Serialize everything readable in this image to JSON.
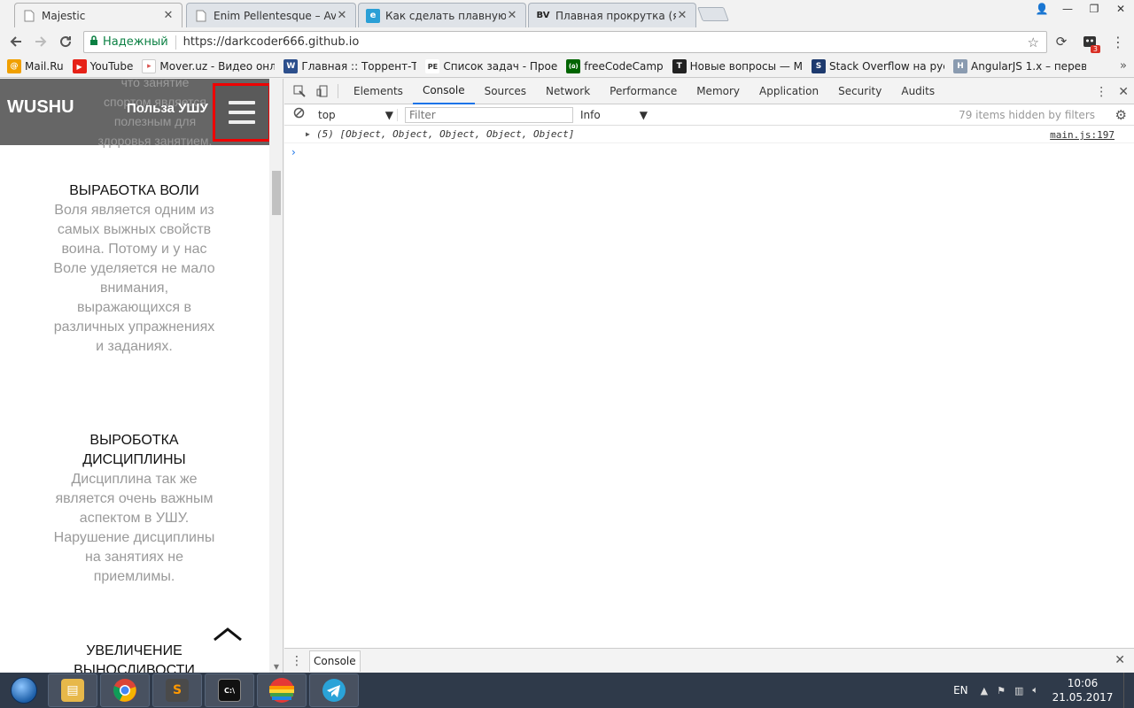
{
  "tabs": [
    {
      "title": "Majestic",
      "icon": "page-icon",
      "active": true
    },
    {
      "title": "Enim Pellentesque – Ava",
      "icon": "page-icon",
      "active": false
    },
    {
      "title": "Как сделать плавную пр",
      "icon": "e-icon",
      "active": false
    },
    {
      "title": "Плавная прокрутка (яко",
      "icon": "bv-icon",
      "active": false
    }
  ],
  "tab_icons": {
    "bv_label": "BV",
    "e_label": "e"
  },
  "window_controls": {
    "user": "👤",
    "minimize": "—",
    "maximize": "❐",
    "close": "✕"
  },
  "address_bar": {
    "secure_label": "Надежный",
    "url": "https://darkcoder666.github.io",
    "ext_badge": "3"
  },
  "bookmarks": [
    {
      "label": "Mail.Ru",
      "icon": "@",
      "color": "#f0a000"
    },
    {
      "label": "YouTube",
      "icon": "▶",
      "color": "#e62117"
    },
    {
      "label": "Mover.uz - Видео онл",
      "icon": "▸",
      "color": "#d9534f"
    },
    {
      "label": "Главная :: Торрент-Тр",
      "icon": "W",
      "color": "#2c4f8c"
    },
    {
      "label": "Список задач - Прое",
      "icon": "PE",
      "color": "#333333"
    },
    {
      "label": "freeCodeCamp",
      "icon": "(۵)",
      "color": "#006400"
    },
    {
      "label": "Новые вопросы — М",
      "icon": "T",
      "color": "#222222"
    },
    {
      "label": "Stack Overflow на рус",
      "icon": "S",
      "color": "#1e3a6e"
    },
    {
      "label": "AngularJS 1.x – перев",
      "icon": "H",
      "color": "#8a9bb0"
    }
  ],
  "bookmarks_more": "»",
  "site": {
    "logo": "WUSHU",
    "nav_title": "Польза УШУ",
    "header_bg_text": "что занятие спортом является полезным для здоровья занятием.",
    "sections": [
      {
        "title": "ВЫРАБОТКА ВОЛИ",
        "text": "Воля является одним из самых выжных свойств воина. Потому и у нас Воле уделяется не мало внимания, выражающихся в различных упражнениях и заданиях."
      },
      {
        "title": "ВЫРОБОТКА ДИСЦИПЛИНЫ",
        "text": "Дисциплина так же является очень важным аспектом в УШУ. Нарушение дисциплины на занятиях не приемлимы."
      },
      {
        "title": "УВЕЛИЧЕНИЕ ВЫНОСЛИВОСТИ",
        "text": ""
      }
    ]
  },
  "devtools": {
    "tabs": [
      "Elements",
      "Console",
      "Sources",
      "Network",
      "Performance",
      "Memory",
      "Application",
      "Security",
      "Audits"
    ],
    "active_tab": "Console",
    "context": "top",
    "filter_placeholder": "Filter",
    "level": "Info",
    "hidden_count": "79 items hidden by filters",
    "messages": [
      {
        "text": "(5) [Object, Object, Object, Object, Object]",
        "source": "main.js:197"
      }
    ],
    "prompt": "›",
    "drawer_tab": "Console"
  },
  "taskbar": {
    "apps": [
      {
        "name": "file-explorer",
        "glyph": "▤",
        "color": "#e7b84a"
      },
      {
        "name": "chrome",
        "glyph": "◉",
        "color": "#4caf50"
      },
      {
        "name": "sublime-text",
        "glyph": "S",
        "color": "#ff9800"
      },
      {
        "name": "command-prompt",
        "glyph": "C:\\",
        "color": "#111111"
      },
      {
        "name": "rainbow-app",
        "glyph": "●",
        "color": "#e64a19"
      },
      {
        "name": "telegram",
        "glyph": "➤",
        "color": "#2aa3d8"
      }
    ],
    "lang": "EN",
    "time": "10:06",
    "date": "21.05.2017"
  },
  "colors": {
    "accent": "#1a73e8",
    "header_bg": "#666666",
    "highlight_border": "#e00000"
  }
}
